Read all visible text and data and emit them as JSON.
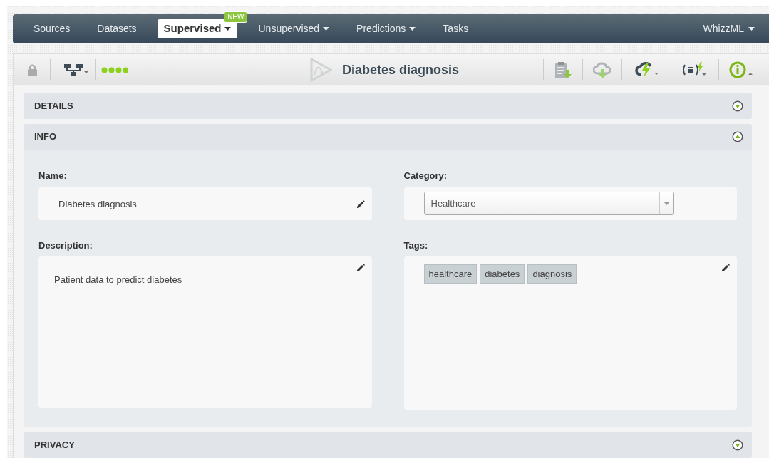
{
  "nav": {
    "items": [
      {
        "label": "Sources",
        "selected": false,
        "dropdown": false
      },
      {
        "label": "Datasets",
        "selected": false,
        "dropdown": false
      },
      {
        "label": "Supervised",
        "selected": true,
        "dropdown": true,
        "badge": "NEW"
      },
      {
        "label": "Unsupervised",
        "selected": false,
        "dropdown": true
      },
      {
        "label": "Predictions",
        "selected": false,
        "dropdown": true
      },
      {
        "label": "Tasks",
        "selected": false,
        "dropdown": false
      }
    ],
    "right": {
      "label": "WhizzML",
      "dropdown": true
    }
  },
  "toolbar": {
    "title": "Diabetes diagnosis"
  },
  "sections": [
    {
      "title": "DETAILS",
      "expanded": false
    },
    {
      "title": "INFO",
      "expanded": true
    },
    {
      "title": "PRIVACY",
      "expanded": false
    }
  ],
  "info": {
    "name": {
      "label": "Name:",
      "value": "Diabetes diagnosis"
    },
    "category": {
      "label": "Category:",
      "value": "Healthcare"
    },
    "description": {
      "label": "Description:",
      "value": "Patient data to predict diabetes"
    },
    "tags": {
      "label": "Tags:",
      "items": [
        "healthcare",
        "diabetes",
        "diagnosis"
      ]
    }
  }
}
